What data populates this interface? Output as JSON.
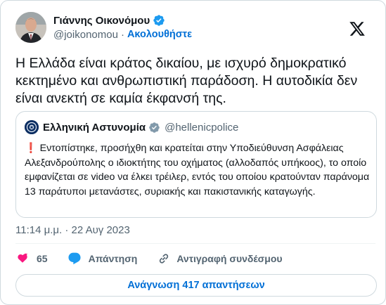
{
  "author": {
    "display_name": "Γιάννης Οικονόμου",
    "handle": "@joikonomou",
    "separator": "·",
    "follow_label": "Ακολουθήστε",
    "verified_icon": "verified-badge-icon",
    "avatar_icon": "avatar-photo"
  },
  "platform_icon": "x-logo-icon",
  "tweet": {
    "text": "Η Ελλάδα είναι κράτος δικαίου, με ισχυρό δημοκρατικό κεκτημένο και ανθρωπιστική παράδοση. Η αυτοδικία δεν είναι ανεκτή σε καμία έκφανσή της.",
    "timestamp": "11:14 μ.μ. · 22 Αυγ 2023"
  },
  "quoted_tweet": {
    "display_name": "Ελληνική Αστυνομία",
    "handle": "@hellenicpolice",
    "badge_icon": "government-badge-icon",
    "exclamation": "❗",
    "text": "Εντοπίστηκε, προσήχθη και κρατείται στην Υποδιεύθυνση Ασφάλειας Αλεξανδρούπολης ο ιδιοκτήτης του οχήματος (αλλοδαπός υπήκοος), το οποίο εμφανίζεται σε video να έλκει τρέιλερ, εντός του οποίου κρατούνταν παράνομα 13 παράτυποι μετανάστες, συριακής και πακιστανικής καταγωγής."
  },
  "actions": {
    "like_count": "65",
    "reply_label": "Απάντηση",
    "copy_link_label": "Αντιγραφή συνδέσμου"
  },
  "read_replies_label": "Ανάγνωση 417 απαντήσεων",
  "colors": {
    "accent": "#006fd6",
    "like": "#f91880",
    "reply": "#1d9bf0",
    "verified": "#1d9bf0",
    "government_badge": "#829aab",
    "muted": "#536471",
    "border": "#cfd9de"
  }
}
